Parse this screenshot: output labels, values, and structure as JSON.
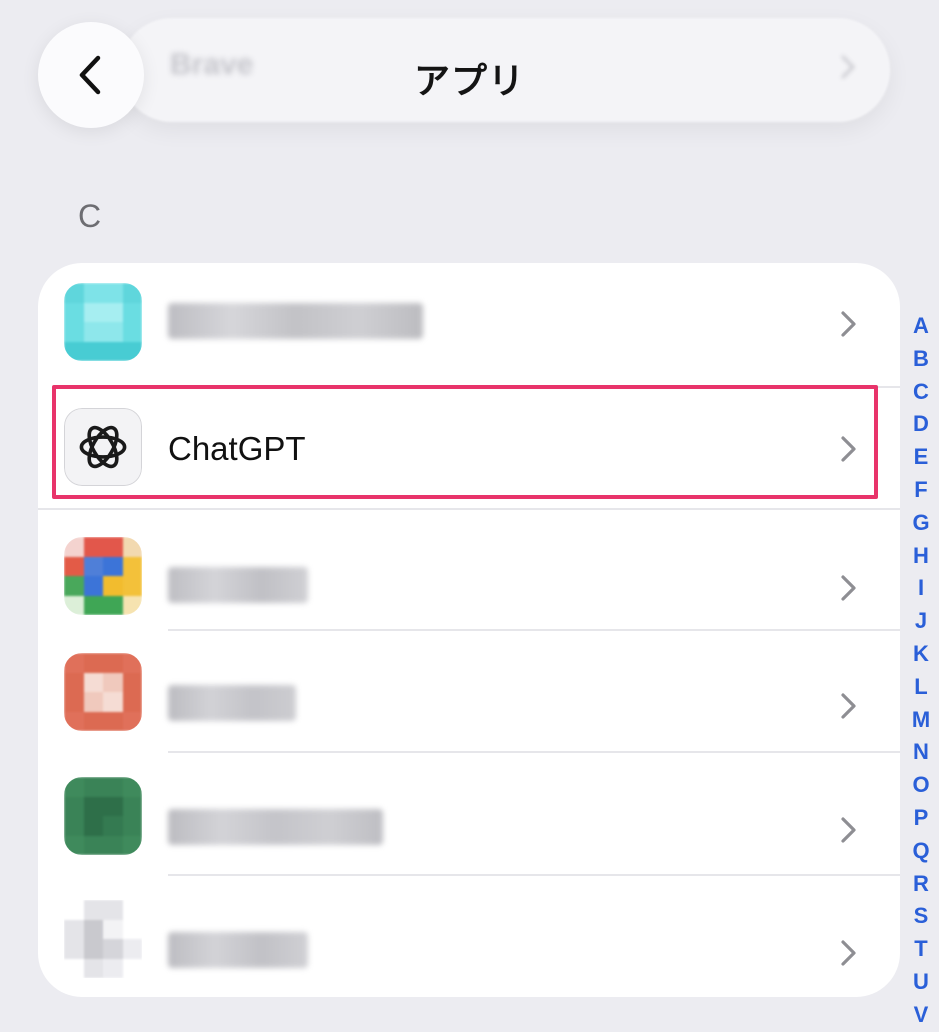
{
  "header": {
    "title": "アプリ",
    "previous_item_blurred": "Brave"
  },
  "section": {
    "letter": "C"
  },
  "rows": [
    {
      "label": "",
      "blurred": true,
      "icon": "blurred-app-icon-cyan"
    },
    {
      "label": "ChatGPT",
      "blurred": false,
      "icon": "openai-logo-icon"
    },
    {
      "label": "",
      "blurred": true,
      "icon": "blurred-app-icon-chrome"
    },
    {
      "label": "",
      "blurred": true,
      "icon": "blurred-app-icon-orange"
    },
    {
      "label": "",
      "blurred": true,
      "icon": "blurred-app-icon-green"
    },
    {
      "label": "",
      "blurred": true,
      "icon": "blurred-app-icon-gray"
    }
  ],
  "index": [
    "A",
    "B",
    "C",
    "D",
    "E",
    "F",
    "G",
    "H",
    "I",
    "J",
    "K",
    "L",
    "M",
    "N",
    "O",
    "P",
    "Q",
    "R",
    "S",
    "T",
    "U",
    "V"
  ],
  "colors": {
    "background": "#ececf1",
    "card": "#ffffff",
    "highlight": "#e8336a",
    "index": "#2a5fd8"
  }
}
